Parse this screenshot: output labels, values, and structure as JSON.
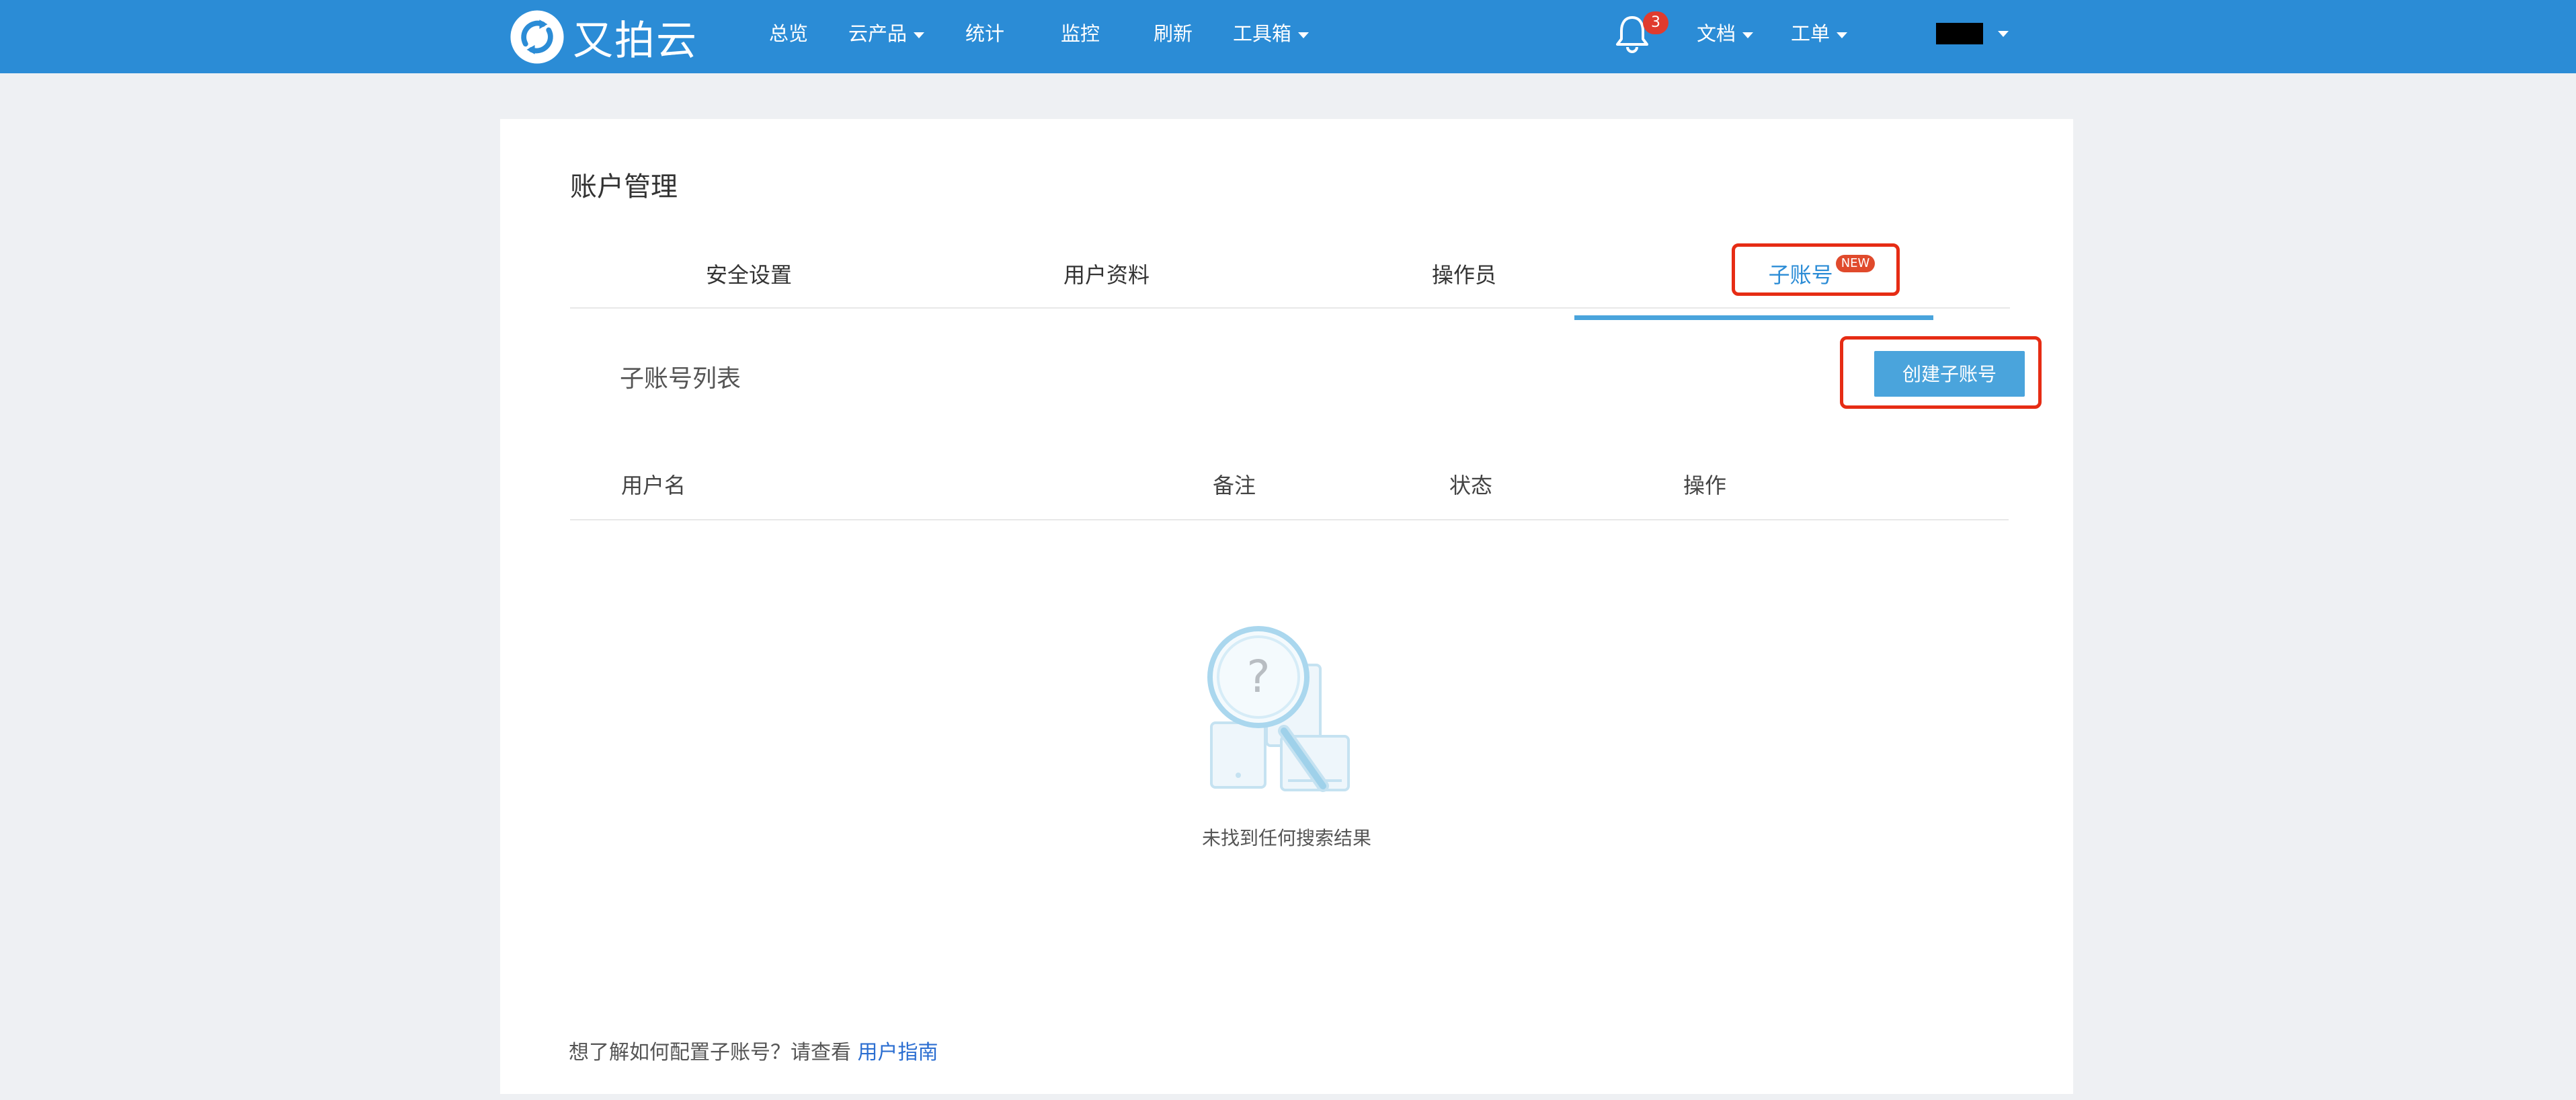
{
  "header": {
    "logo_text": "又拍云",
    "nav": [
      {
        "label": "总览"
      },
      {
        "label": "云产品"
      },
      {
        "label": "统计"
      },
      {
        "label": "监控"
      },
      {
        "label": "刷新"
      },
      {
        "label": "工具箱"
      }
    ],
    "notification_count": "3",
    "right_nav": [
      {
        "label": "文档"
      },
      {
        "label": "工单"
      }
    ],
    "brand_color": "#2b8cd6"
  },
  "page": {
    "title": "账户管理",
    "tabs": [
      {
        "label": "安全设置"
      },
      {
        "label": "用户资料"
      },
      {
        "label": "操作员"
      },
      {
        "label": "子账号",
        "badge": "NEW",
        "active": true
      }
    ],
    "section_title": "子账号列表",
    "create_button": "创建子账号",
    "table": {
      "columns": [
        "用户名",
        "备注",
        "状态",
        "操作"
      ],
      "rows": []
    },
    "empty_text": "未找到任何搜索结果",
    "footer_text": "想了解如何配置子账号？请查看",
    "footer_link": "用户指南"
  }
}
